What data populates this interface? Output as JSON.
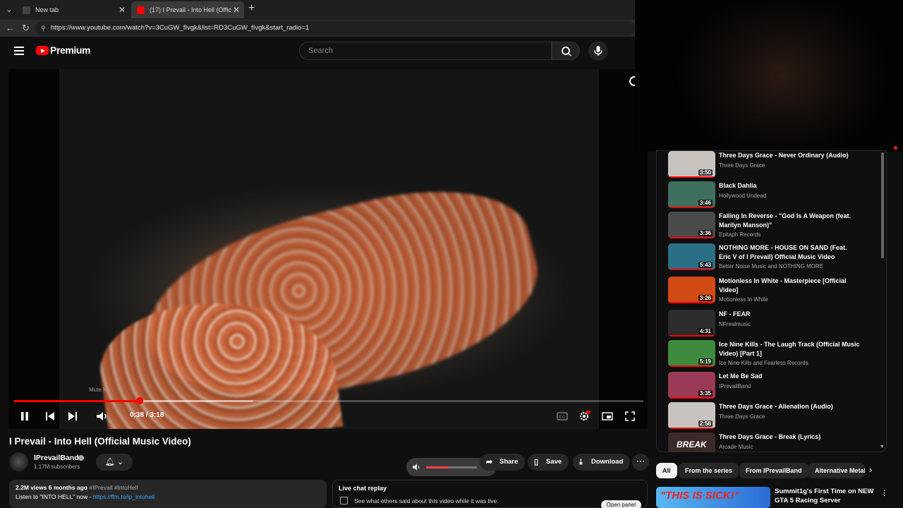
{
  "browser": {
    "tabs": [
      {
        "label": "New tab"
      },
      {
        "label": "(17) I Prevail - Into Hell (Offic"
      }
    ],
    "url": "https://www.youtube.com/watch?v=3CuGW_fIvgk&list=RD3CuGW_fIvgk&start_radio=1"
  },
  "header": {
    "brand": "Premium",
    "search_placeholder": "Search"
  },
  "player": {
    "time": "0:38 / 3:18",
    "tooltip": "Mute  M",
    "progress_fraction": 0.2,
    "buffer_fraction": 0.38,
    "volume_level": 46,
    "volume_fraction": 0.46
  },
  "video": {
    "title": "I Prevail - Into Hell (Official Music Video)",
    "channel": "IPrevailBand",
    "subscribers": "1.17M subscribers",
    "actions": {
      "share": "Share",
      "save": "Save",
      "download": "Download"
    },
    "description": {
      "views_date": "2.2M views  6 months ago",
      "tags": "#IPrevail #IntoHell",
      "line_prefix": "Listen to \"INTO HELL\" now - ",
      "link": "https://ffm.to/ip_intohell"
    },
    "chat": {
      "title": "Live chat replay",
      "text": "See what others said about this video while it was live.",
      "button": "Open panel"
    }
  },
  "playlist": {
    "items": [
      {
        "title": "Three Days Grace - Never Ordinary (Audio)",
        "channel": "Three Days Grace",
        "duration": "3:50",
        "color": "#c9c3c0"
      },
      {
        "title": "Black Dahlia",
        "channel": "Hollywood Undead",
        "duration": "3:46",
        "color": "#3f6f5e"
      },
      {
        "title": "Falling In Reverse - \"God Is A Weapon (feat. Marilyn Manson)\"",
        "channel": "Epitaph Records",
        "duration": "3:36",
        "color": "#4a4a4a"
      },
      {
        "title": "NOTHING MORE - HOUSE ON SAND (Feat. Eric V of I Prevail) Official Music Video",
        "channel": "Better Noise Music and NOTHING MORE",
        "duration": "5:43",
        "color": "#2b6f86"
      },
      {
        "title": "Motionless In White - Masterpiece [Official Video]",
        "channel": "Motionless In White",
        "duration": "3:26",
        "color": "#d24a14"
      },
      {
        "title": "NF - FEAR",
        "channel": "NFrealmusic",
        "duration": "4:31",
        "color": "#2d2d2d"
      },
      {
        "title": "Ice Nine Kills - The Laugh Track (Official Music Video) [Part 1]",
        "channel": "Ice Nine Kills and Fearless Records",
        "duration": "5:19",
        "color": "#3e8a3e"
      },
      {
        "title": "Let Me Be Sad",
        "channel": "IPrevailBand",
        "duration": "3:35",
        "color": "#9a3a57"
      },
      {
        "title": "Three Days Grace - Alienation (Audio)",
        "channel": "Three Days Grace",
        "duration": "2:58",
        "color": "#c9c3c0"
      },
      {
        "title": "Three Days Grace - Break (Lyrics)",
        "channel": "Arcade Music",
        "duration": "",
        "thumb_text": "BREAK",
        "color": "#3a2a2a"
      }
    ]
  },
  "chips": [
    "All",
    "From the series",
    "From IPrevailBand",
    "Alternative Metal"
  ],
  "recommended": {
    "thumb_text": "\"THIS IS SICK!\"",
    "title": "Summit1g's First Time on NEW GTA 5 Racing Server"
  },
  "icons": {
    "tab_menu": "chevron-down-icon",
    "back": "arrow-left-icon",
    "reload": "reload-icon"
  }
}
